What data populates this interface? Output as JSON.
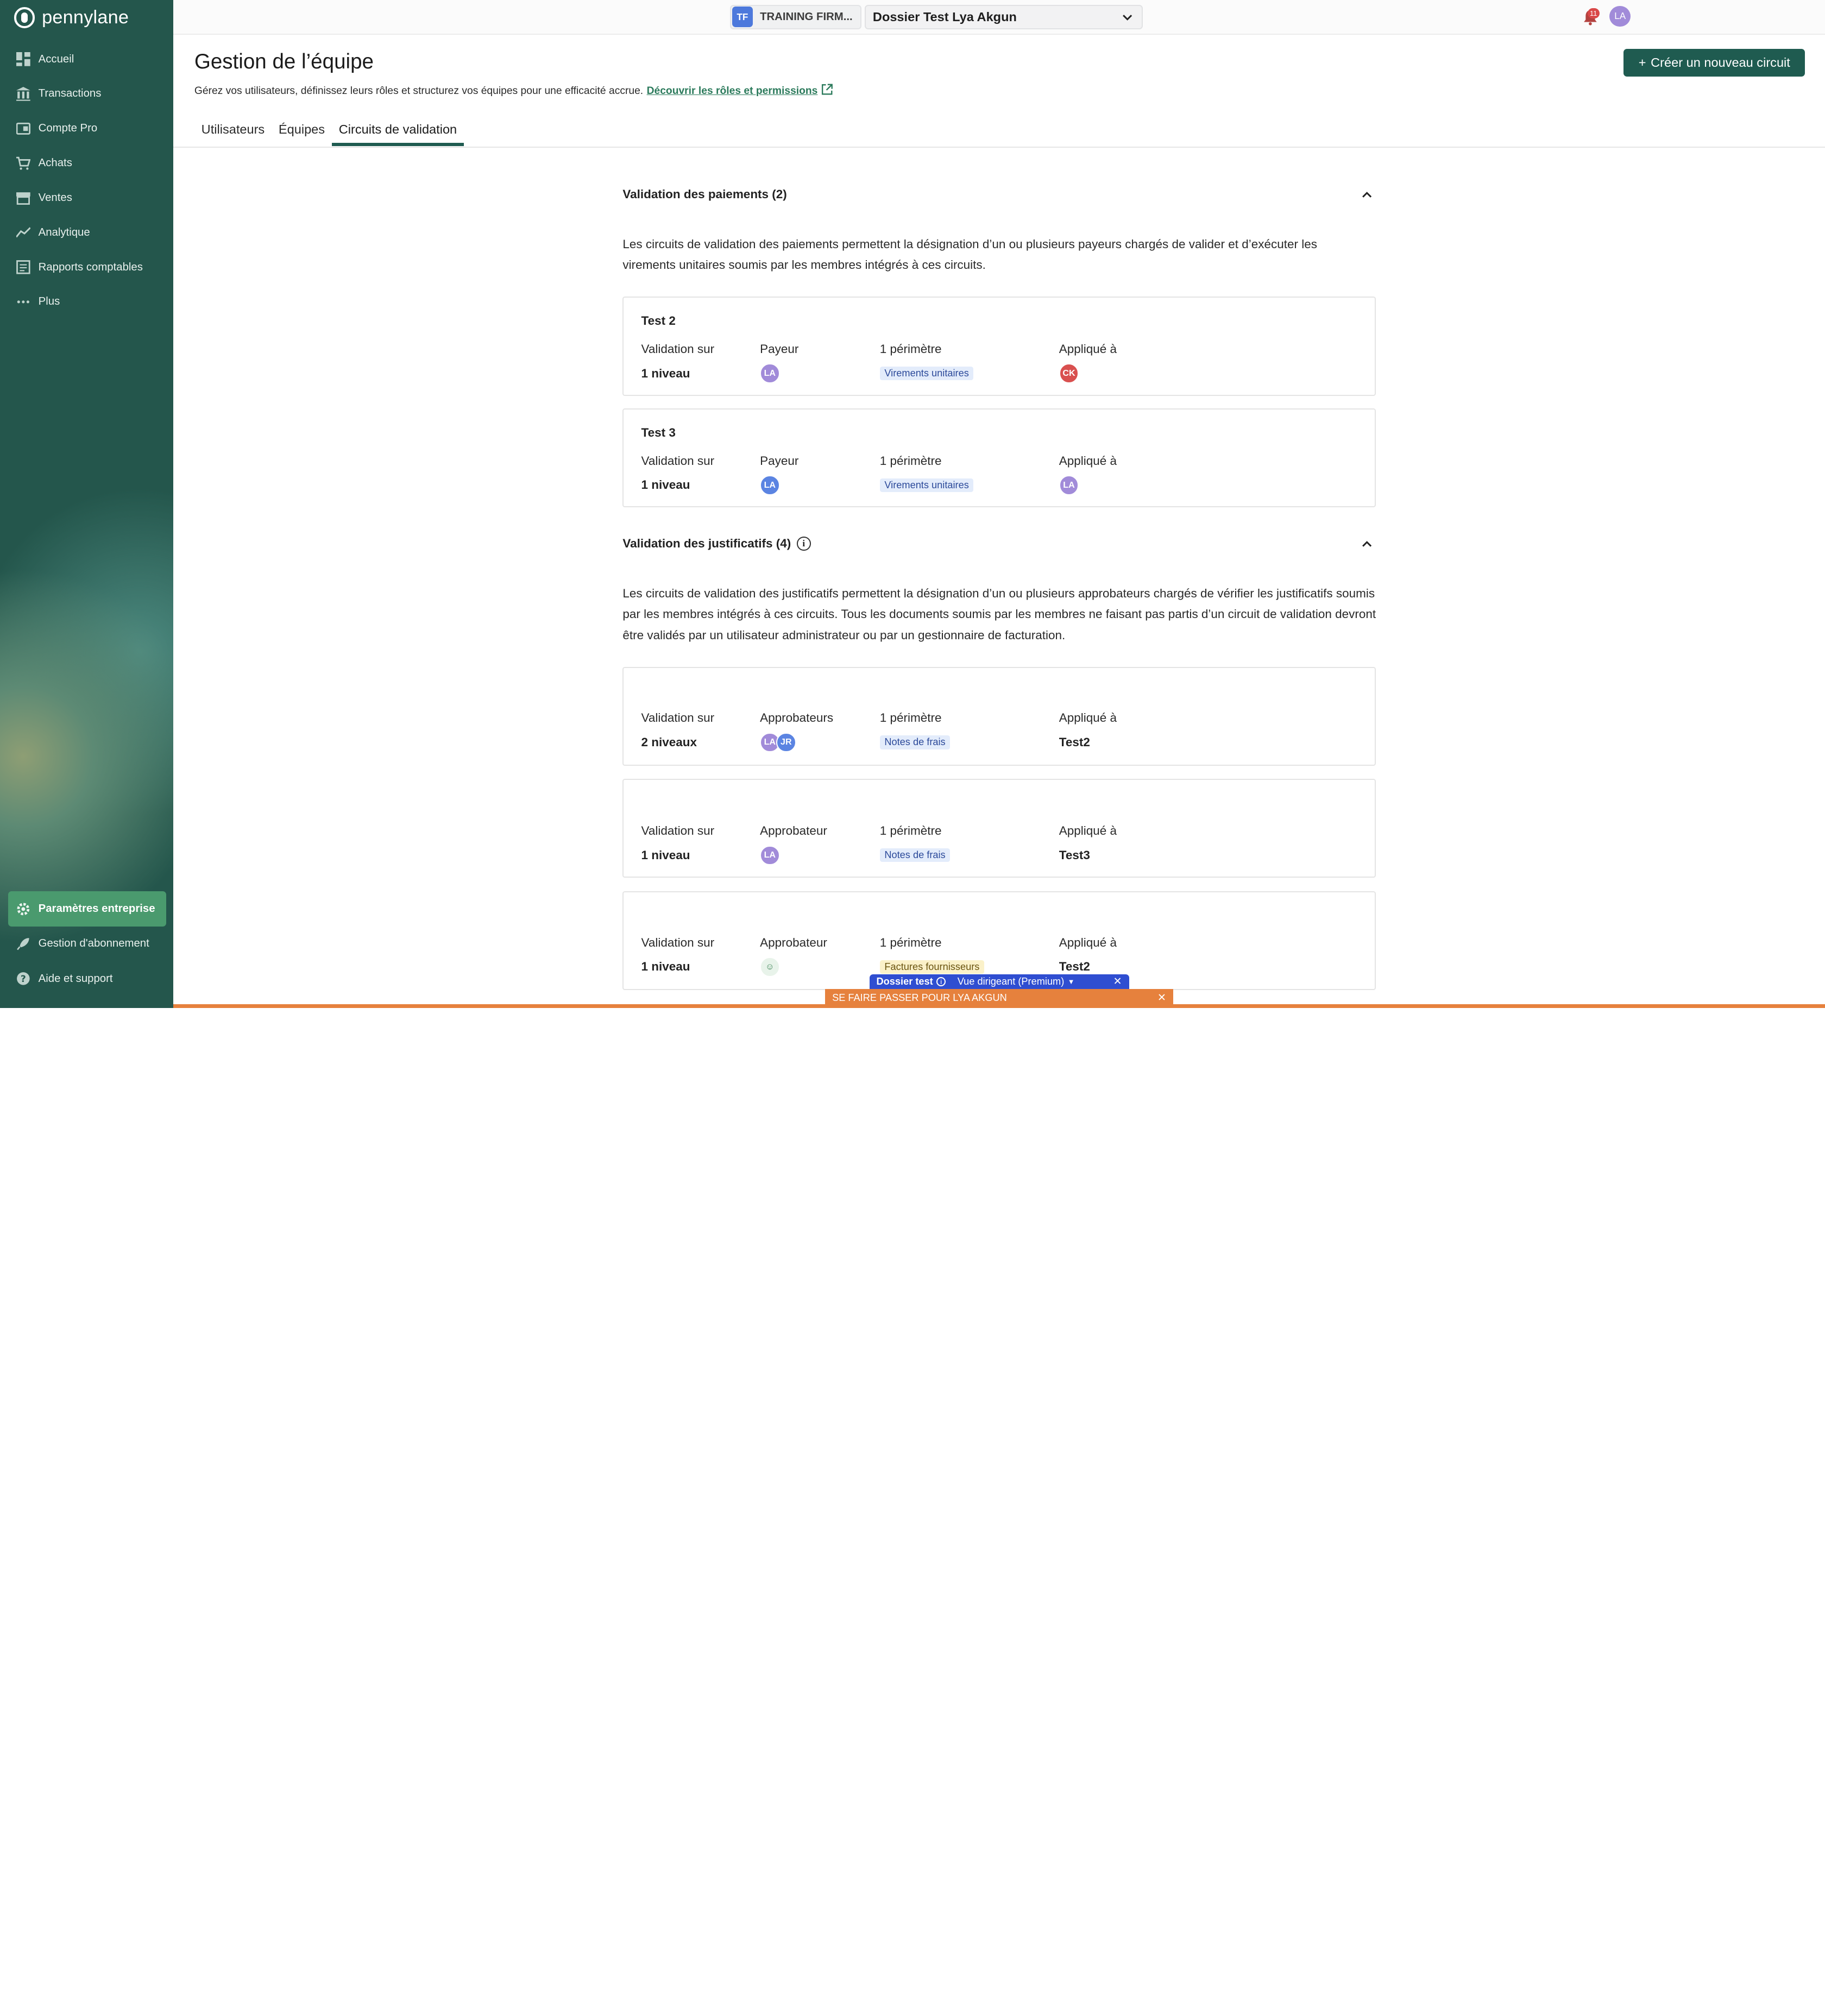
{
  "brand": {
    "name": "pennylane"
  },
  "sidebar": {
    "items": [
      {
        "label": "Accueil",
        "icon": "dashboard-icon"
      },
      {
        "label": "Transactions",
        "icon": "bank-icon"
      },
      {
        "label": "Compte Pro",
        "icon": "card-icon"
      },
      {
        "label": "Achats",
        "icon": "cart-icon"
      },
      {
        "label": "Ventes",
        "icon": "store-icon"
      },
      {
        "label": "Analytique",
        "icon": "chart-line-icon"
      },
      {
        "label": "Rapports comptables",
        "icon": "report-icon"
      },
      {
        "label": "Plus",
        "icon": "more-icon"
      }
    ],
    "bottom": [
      {
        "label": "Paramètres entreprise",
        "icon": "gear-icon"
      },
      {
        "label": "Gestion d'abonnement",
        "icon": "rocket-icon"
      },
      {
        "label": "Aide et support",
        "icon": "help-icon"
      }
    ]
  },
  "topbar": {
    "firm_badge": "TF",
    "firm_name": "TRAINING FIRM...",
    "dossier": "Dossier Test Lya Akgun",
    "notif_count": "11",
    "user_initials": "LA"
  },
  "header": {
    "title": "Gestion de l’équipe",
    "subtitle": "Gérez vos utilisateurs, définissez leurs rôles et structurez vos équipes pour une efficacité accrue.",
    "link": "Découvrir les rôles et permissions",
    "create_button": "Créer un nouveau circuit",
    "tabs": [
      "Utilisateurs",
      "Équipes",
      "Circuits de validation"
    ]
  },
  "payments": {
    "title": "Validation des paiements (2)",
    "description": "Les circuits de validation des paiements permettent la désignation d’un ou plusieurs payeurs chargés de valider et d’exécuter les virements unitaires soumis par les membres intégrés à ces circuits.",
    "cards": [
      {
        "name": "Test 2",
        "validation_label": "Validation sur",
        "validation_value": "1 niveau",
        "role_label": "Payeur",
        "role_avatars": [
          {
            "initials": "LA",
            "color": "#a18bd9"
          }
        ],
        "scope_label": "1 périmètre",
        "scope_tag": "Virements unitaires",
        "applied_label": "Appliqué à",
        "applied_avatar": {
          "initials": "CK",
          "color": "#d9504f"
        }
      },
      {
        "name": "Test 3",
        "validation_label": "Validation sur",
        "validation_value": "1 niveau",
        "role_label": "Payeur",
        "role_avatars": [
          {
            "initials": "LA",
            "color": "#5b84e2"
          }
        ],
        "scope_label": "1 périmètre",
        "scope_tag": "Virements unitaires",
        "applied_label": "Appliqué à",
        "applied_avatar": {
          "initials": "LA",
          "color": "#a18bd9"
        }
      }
    ]
  },
  "justificatifs": {
    "title": "Validation des justificatifs (4)",
    "description": "Les circuits de validation des justificatifs permettent la désignation d’un ou plusieurs approbateurs chargés de vérifier les justificatifs soumis par les membres intégrés à ces circuits. Tous les documents soumis par les membres ne faisant pas partis d’un circuit de validation devront être validés par un utilisateur administrateur ou par un gestionnaire de facturation.",
    "cards": [
      {
        "validation_label": "Validation sur",
        "validation_value": "2 niveaux",
        "role_label": "Approbateurs",
        "role_avatars": [
          {
            "initials": "LA",
            "color": "#a18bd9"
          },
          {
            "initials": "JR",
            "color": "#5b84e2"
          }
        ],
        "scope_label": "1 périmètre",
        "scope_tag": "Notes de frais",
        "applied_label": "Appliqué à",
        "applied_text": "Test2"
      },
      {
        "validation_label": "Validation sur",
        "validation_value": "1 niveau",
        "role_label": "Approbateur",
        "role_avatars": [
          {
            "initials": "LA",
            "color": "#a18bd9"
          }
        ],
        "scope_label": "1 périmètre",
        "scope_tag": "Notes de frais",
        "applied_label": "Appliqué à",
        "applied_text": "Test3"
      },
      {
        "validation_label": "Validation sur",
        "validation_value": "1 niveau",
        "role_label": "Approbateur",
        "role_avatars": [
          {
            "initials": "☺",
            "color": "#e8f3ea"
          }
        ],
        "scope_label": "1 périmètre",
        "scope_tag": "Factures fournisseurs",
        "applied_label": "Appliqué à",
        "applied_text": "Test2"
      }
    ]
  },
  "dev_bar": {
    "dossier": "Dossier test",
    "view": "Vue dirigeant (Premium)"
  },
  "impersonate": {
    "label": "SE FAIRE PASSER POUR LYA AKGUN"
  },
  "colors": {
    "sidebar_bg": "#24564c",
    "accent": "#1f5b50",
    "link": "#2b7a5b",
    "tag_virement_bg": "#e3ecfb",
    "tag_virement_fg": "#2c4a9a",
    "tag_fournisseur_bg": "#fbf1c9",
    "tag_fournisseur_fg": "#6a5410"
  }
}
